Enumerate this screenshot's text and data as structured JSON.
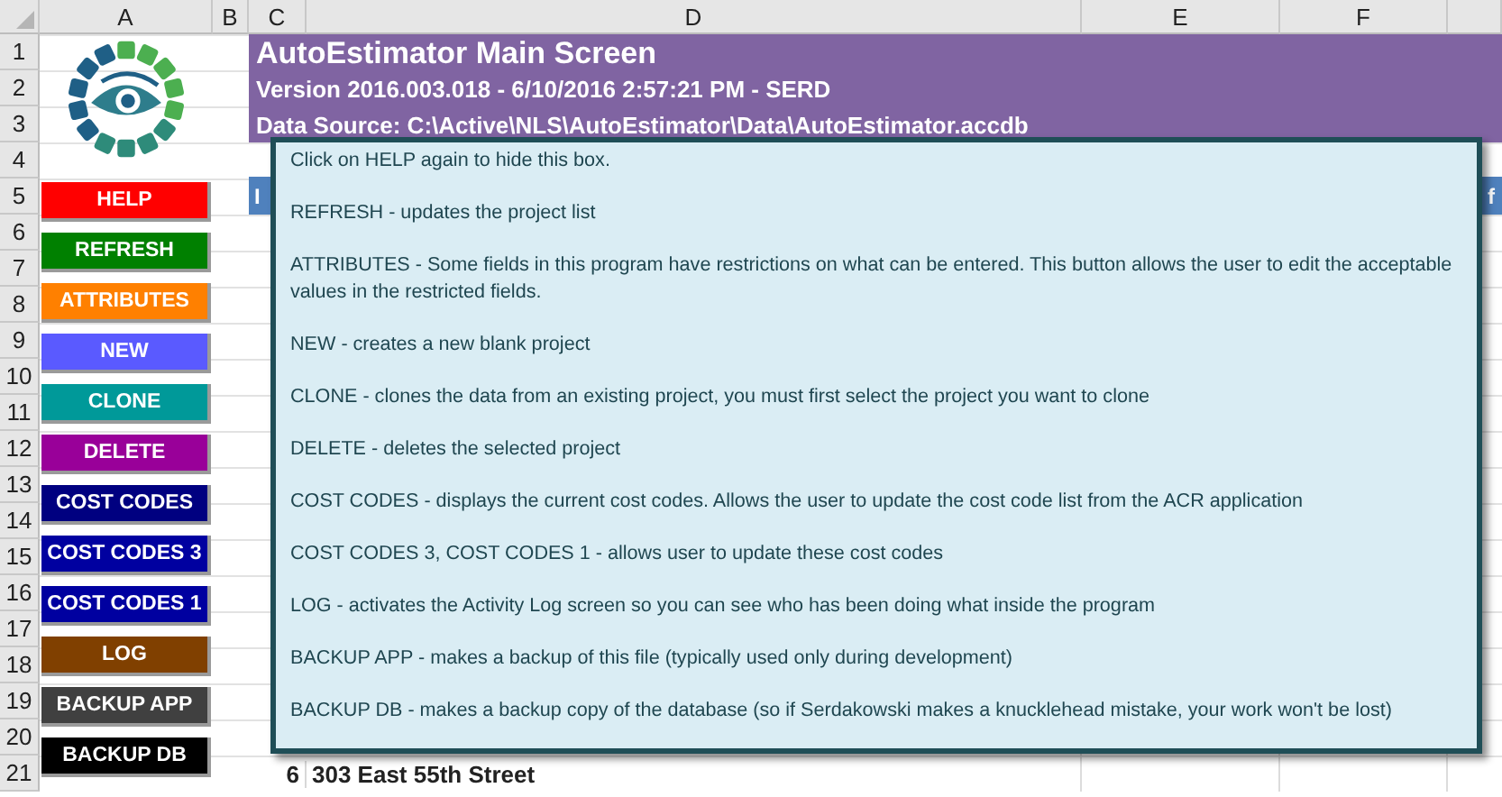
{
  "columns": [
    "A",
    "B",
    "C",
    "D",
    "E",
    "F"
  ],
  "row_numbers": [
    "1",
    "2",
    "3",
    "4",
    "5",
    "6",
    "7",
    "8",
    "9",
    "10",
    "11",
    "12",
    "13",
    "14",
    "15",
    "16",
    "17",
    "18",
    "19",
    "20",
    "21"
  ],
  "banner": {
    "title": "AutoEstimator Main Screen",
    "version": "Version 2016.003.018 - 6/10/2016 2:57:21 PM - SERD",
    "data_source": "Data Source: C:\\Active\\NLS\\AutoEstimator\\Data\\AutoEstimator.accdb"
  },
  "table_header": [
    "I",
    "f"
  ],
  "last_row": [
    "6",
    "303 East 55th Street"
  ],
  "buttons": [
    {
      "label": "HELP",
      "color": "#ff0000"
    },
    {
      "label": "REFRESH",
      "color": "#008000"
    },
    {
      "label": "ATTRIBUTES",
      "color": "#ff8000"
    },
    {
      "label": "NEW",
      "color": "#5a5aff"
    },
    {
      "label": "CLONE",
      "color": "#009999"
    },
    {
      "label": "DELETE",
      "color": "#990099"
    },
    {
      "label": "COST CODES",
      "color": "#000080"
    },
    {
      "label": "COST CODES 3",
      "color": "#0000a0"
    },
    {
      "label": "COST CODES 1",
      "color": "#0000a0"
    },
    {
      "label": "LOG",
      "color": "#804000"
    },
    {
      "label": "BACKUP APP",
      "color": "#404040"
    },
    {
      "label": "BACKUP DB",
      "color": "#000000"
    }
  ],
  "help_box": [
    "Click on HELP again to hide this box.",
    "REFRESH - updates the project list",
    "ATTRIBUTES - Some fields in this program have restrictions on what can be entered.  This button allows the user to edit the acceptable values in the restricted fields.",
    "NEW - creates a new blank project",
    "CLONE - clones the data from an existing project, you must first select the project you want to clone",
    "DELETE - deletes the selected project",
    "COST CODES - displays the current cost codes.  Allows the user to update the cost code list from the ACR application",
    "COST CODES 3, COST CODES 1 - allows user to update these cost codes",
    "LOG - activates the Activity Log screen so you can see who has been doing what inside the program",
    "BACKUP APP - makes a backup of this file (typically used only during development)",
    "BACKUP DB - makes a backup copy of the database (so if Serdakowski makes a knucklehead mistake, your work won't be lost)"
  ]
}
